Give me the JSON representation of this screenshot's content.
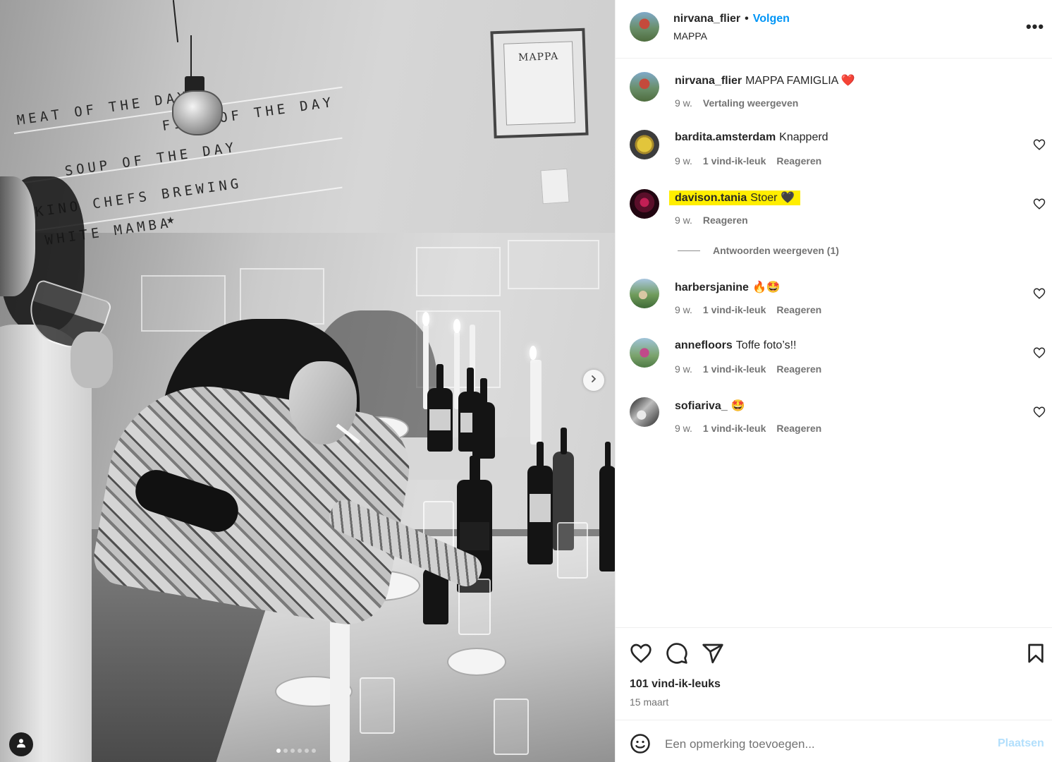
{
  "photo": {
    "menu_board": [
      "MEAT OF THE DAY",
      "FISH OF THE DAY",
      "SOUP OF THE DAY",
      "KINO CHEFS BREWING",
      "WHITE MAMBA",
      "★"
    ],
    "frame_text": "MAPPA",
    "carousel": {
      "total": 6,
      "active": 1
    }
  },
  "header": {
    "username": "nirvana_flier",
    "separator": "•",
    "follow_label": "Volgen",
    "location": "MAPPA",
    "more_icon": "more-horizontal-icon",
    "more_label": "•••"
  },
  "caption": {
    "username": "nirvana_flier",
    "text": "MAPPA FAMIGLIA ❤️",
    "time": "9 w.",
    "translate_label": "Vertaling weergeven"
  },
  "comments": [
    {
      "username": "bardita.amsterdam",
      "text": "Knapperd",
      "time": "9 w.",
      "likes": "1 vind-ik-leuk",
      "reply": "Reageren"
    },
    {
      "username": "davison.tania",
      "text": "Stoer 🖤",
      "time": "9 w.",
      "likes": "",
      "reply": "Reageren",
      "highlighted": true
    },
    {
      "username": "harbersjanine",
      "text": "🔥🤩",
      "time": "9 w.",
      "likes": "1 vind-ik-leuk",
      "reply": "Reageren"
    },
    {
      "username": "annefloors",
      "text": "Toffe foto’s!!",
      "time": "9 w.",
      "likes": "1 vind-ik-leuk",
      "reply": "Reageren"
    },
    {
      "username": "sofiariva_",
      "text": "🤩",
      "time": "9 w.",
      "likes": "1 vind-ik-leuk",
      "reply": "Reageren"
    }
  ],
  "replies_label": "Antwoorden weergeven (1)",
  "actions": {
    "icons": [
      "heart-icon",
      "comment-icon",
      "share-icon",
      "bookmark-icon"
    ],
    "likes_count": "101 vind-ik-leuks",
    "date": "15 maart"
  },
  "composer": {
    "placeholder": "Een opmerking toevoegen...",
    "post_label": "Plaatsen"
  },
  "colors": {
    "link_blue": "#0095f6",
    "muted_text": "#737373",
    "highlight": "#ffee00",
    "post_disabled": "#b2dffc"
  }
}
